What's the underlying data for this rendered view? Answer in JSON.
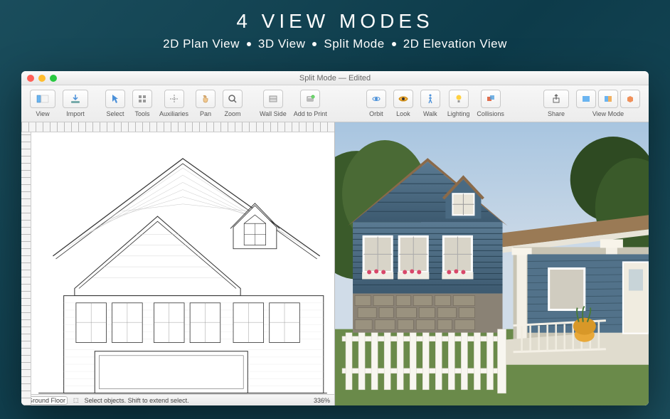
{
  "promo": {
    "title": "4 VIEW MODES",
    "modes": [
      "2D Plan View",
      "3D View",
      "Split Mode",
      "2D Elevation View"
    ]
  },
  "window": {
    "title": "Split Mode — Edited"
  },
  "toolbar": {
    "view": "View",
    "import": "Import",
    "select": "Select",
    "tools": "Tools",
    "auxiliaries": "Auxiliaries",
    "pan": "Pan",
    "zoom": "Zoom",
    "wallside": "Wall Side",
    "addtoprint": "Add to Print",
    "orbit": "Orbit",
    "look": "Look",
    "walk": "Walk",
    "lighting": "Lighting",
    "collisions": "Collisions",
    "share": "Share",
    "viewmode": "View Mode"
  },
  "statusbar": {
    "floor": "Ground Floor",
    "hint": "Select objects. Shift to extend select.",
    "zoom": "336%"
  }
}
